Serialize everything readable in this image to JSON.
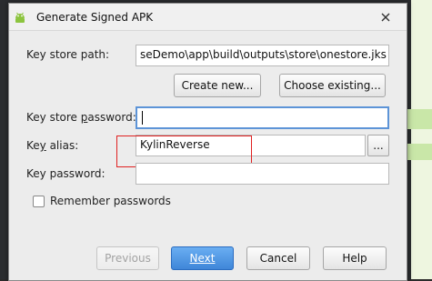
{
  "dialog": {
    "title": "Generate Signed APK"
  },
  "fields": {
    "key_store_path": {
      "label": "Key store path:",
      "value": "seDemo\\app\\build\\outputs\\store\\onestore.jks"
    },
    "key_store_password": {
      "label_pre": "Key store ",
      "label_u": "p",
      "label_post": "assword:",
      "value": ""
    },
    "key_alias": {
      "label_pre": "Ke",
      "label_u": "y",
      "label_post": " alias:",
      "value": "KylinReverse"
    },
    "key_password": {
      "label": "Key password:",
      "value": ""
    }
  },
  "buttons": {
    "create_new": "Create new...",
    "choose_existing": "Choose existing...",
    "browse": "...",
    "previous": "Previous",
    "next": "Next",
    "cancel": "Cancel",
    "help": "Help"
  },
  "remember": {
    "label": "Remember passwords",
    "checked": false
  },
  "colors": {
    "primary": "#3f86d8",
    "highlight": "#e02020",
    "focus": "#5d94d7"
  }
}
